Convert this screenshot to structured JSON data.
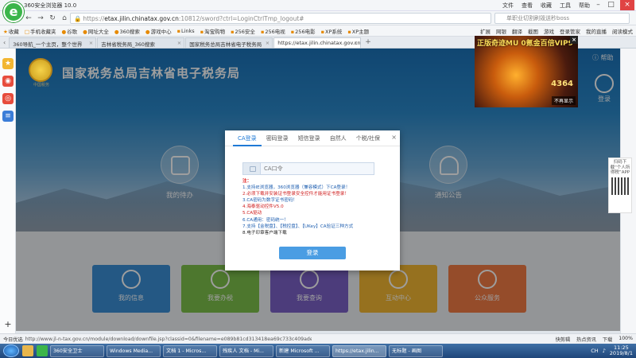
{
  "browser": {
    "title": "360安全浏览器 10.0",
    "menus": [
      "文件",
      "查看",
      "收藏",
      "工具",
      "帮助"
    ],
    "url_scheme": "https://",
    "url_host": "etax.jilin.chinatax.gov.cn",
    "url_rest": ":10812/sword?ctrl=LoginCtrlTmp_logout#",
    "search_placeholder": "单职业切割刷毁送秒boss",
    "bookmarks": [
      "收藏",
      "手机收藏夹",
      "谷歌",
      "网址大全",
      "360搜索",
      "游戏中心",
      "Links",
      "淘宝购物",
      "256安全",
      "256电视",
      "256电影",
      "XP系统",
      "XP主题"
    ],
    "bookmarks_right": [
      "扩展",
      "网银",
      "翻译",
      "截图",
      "游戏",
      "登录管家",
      "我的直播",
      "阅读模式"
    ],
    "tabs": [
      {
        "label": "360导航_一个主页，整个世界"
      },
      {
        "label": "吉林省税务局_360搜索"
      },
      {
        "label": "国家税务总局吉林省电子税务局"
      },
      {
        "label": "https://etax.jilin.chinatax.gov.cn"
      }
    ]
  },
  "page": {
    "emblem_text": "中国税务",
    "site_title": "国家税务总局吉林省电子税务局",
    "help": "帮助",
    "login": "登录",
    "hero_items": [
      {
        "label": "我的待办"
      },
      {
        "label": "通知公告"
      }
    ],
    "tiles": [
      {
        "label": "我的信息",
        "color": "#3b8fd6"
      },
      {
        "label": "我要办税",
        "color": "#7cc04b"
      },
      {
        "label": "我要查询",
        "color": "#7b61c7"
      },
      {
        "label": "互动中心",
        "color": "#f2b632"
      },
      {
        "label": "公众服务",
        "color": "#f07b45"
      }
    ]
  },
  "modal": {
    "tabs": [
      "CA登录",
      "密码登录",
      "短信登录",
      "自然人",
      "个税/社保"
    ],
    "active_tab": "CA登录",
    "input_placeholder": "CA口令",
    "notes_title": "注：",
    "notes": [
      {
        "text": "1.支持IE浏览器，360浏览器（兼容模式）下CA登录！",
        "color": "blue"
      },
      {
        "text": "2.必须下载并安装证书登录安全控件才能用证书登录！",
        "color": "red"
      },
      {
        "text": "3.CA密码为数字证书密码！",
        "color": "blue"
      },
      {
        "text": "4.海泰驱动控件V5.0",
        "color": "red"
      },
      {
        "text": "5.CA驱动",
        "color": "red"
      },
      {
        "text": "6.CA通用：密码统一！",
        "color": "blue"
      },
      {
        "text": "7.支持【金税盘】、【税控盘】、【UKey】CA验证三种方式",
        "color": "blue"
      },
      {
        "text": "8.电子印章客户端下载",
        "color": "black"
      }
    ],
    "login_button": "登录",
    "close": "×"
  },
  "ad": {
    "title": "正版奇迹MU 0氪金百倍VIP9",
    "number": "4364",
    "no_show": "不再显示",
    "close": "×"
  },
  "qr": {
    "text": "扫码下载“个人所得税”APP"
  },
  "status": {
    "left": "今日优选",
    "url": "http://www.jl-n-tax.gov.cn/module/download/downfile.jsp?classid=0&filename=e089b81cd313418ea69c733c409ade6.rar",
    "right": [
      "快剪辑",
      "热点资讯",
      "下载",
      "100%"
    ]
  },
  "taskbar": {
    "tasks": [
      {
        "label": "360安全卫士",
        "active": false
      },
      {
        "label": "Windows Media...",
        "active": false
      },
      {
        "label": "文档 1 - Micros...",
        "active": false
      },
      {
        "label": "残疾人 文档 - Mi...",
        "active": false
      },
      {
        "label": "新建 Microsoft ...",
        "active": false
      },
      {
        "label": "https://etax.jilin...",
        "active": true
      },
      {
        "label": "无标题 - 画图",
        "active": false
      }
    ],
    "lang": "CH",
    "time": "11:25",
    "date": "2019/8/1"
  }
}
